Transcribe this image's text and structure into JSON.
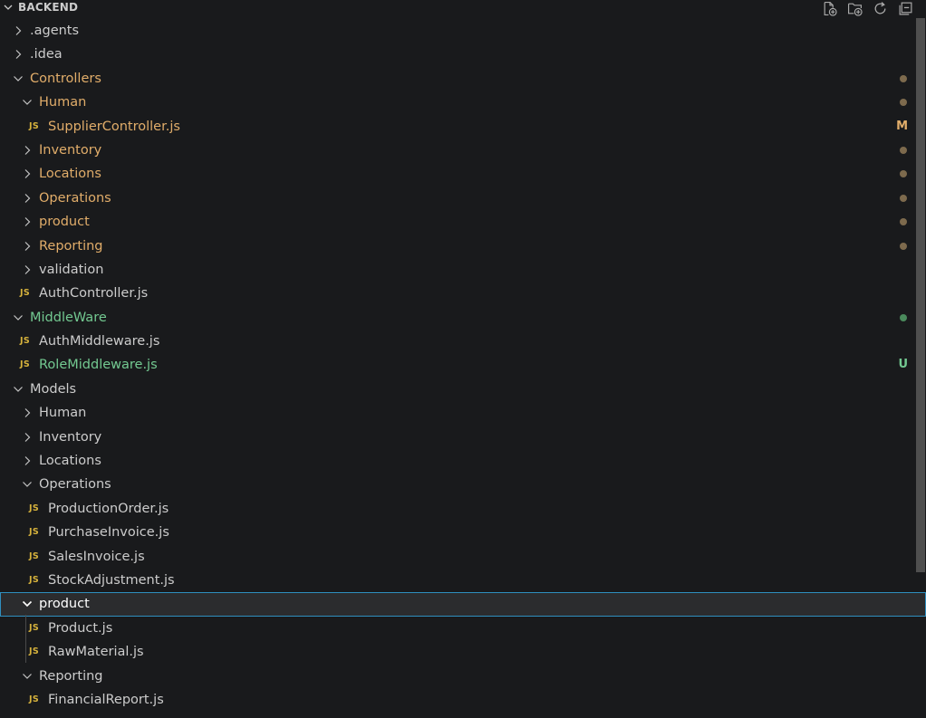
{
  "header": {
    "title": "BACKEND",
    "actions": [
      {
        "icon": "new-file-icon"
      },
      {
        "icon": "new-folder-icon"
      },
      {
        "icon": "refresh-icon"
      },
      {
        "icon": "collapse-all-icon"
      }
    ]
  },
  "colors": {
    "default": "#cccccc",
    "modified": "#e1ad6a",
    "untracked": "#73c991",
    "modified_dot": "#7d6a4d",
    "untracked_dot": "#4a8a5c",
    "js_icon": "#d6b23c",
    "selection_border": "#2f8fbf"
  },
  "tree": [
    {
      "label": ".agents",
      "type": "folder",
      "expanded": false,
      "depth": 0,
      "status": "default"
    },
    {
      "label": ".idea",
      "type": "folder",
      "expanded": false,
      "depth": 0,
      "status": "default"
    },
    {
      "label": "Controllers",
      "type": "folder",
      "expanded": true,
      "depth": 0,
      "status": "modified",
      "decoration": "dot"
    },
    {
      "label": "Human",
      "type": "folder",
      "expanded": true,
      "depth": 1,
      "status": "modified",
      "decoration": "dot"
    },
    {
      "label": "SupplierController.js",
      "type": "file",
      "depth": 2,
      "status": "modified",
      "decoration": "M"
    },
    {
      "label": "Inventory",
      "type": "folder",
      "expanded": false,
      "depth": 1,
      "status": "modified",
      "decoration": "dot"
    },
    {
      "label": "Locations",
      "type": "folder",
      "expanded": false,
      "depth": 1,
      "status": "modified",
      "decoration": "dot"
    },
    {
      "label": "Operations",
      "type": "folder",
      "expanded": false,
      "depth": 1,
      "status": "modified",
      "decoration": "dot"
    },
    {
      "label": "product",
      "type": "folder",
      "expanded": false,
      "depth": 1,
      "status": "modified",
      "decoration": "dot"
    },
    {
      "label": "Reporting",
      "type": "folder",
      "expanded": false,
      "depth": 1,
      "status": "modified",
      "decoration": "dot"
    },
    {
      "label": "validation",
      "type": "folder",
      "expanded": false,
      "depth": 1,
      "status": "default"
    },
    {
      "label": "AuthController.js",
      "type": "file",
      "depth": 1,
      "status": "default"
    },
    {
      "label": "MiddleWare",
      "type": "folder",
      "expanded": true,
      "depth": 0,
      "status": "untracked",
      "decoration": "dot"
    },
    {
      "label": "AuthMiddleware.js",
      "type": "file",
      "depth": 1,
      "status": "default"
    },
    {
      "label": "RoleMiddleware.js",
      "type": "file",
      "depth": 1,
      "status": "untracked",
      "decoration": "U"
    },
    {
      "label": "Models",
      "type": "folder",
      "expanded": true,
      "depth": 0,
      "status": "default"
    },
    {
      "label": "Human",
      "type": "folder",
      "expanded": false,
      "depth": 1,
      "status": "default"
    },
    {
      "label": "Inventory",
      "type": "folder",
      "expanded": false,
      "depth": 1,
      "status": "default"
    },
    {
      "label": "Locations",
      "type": "folder",
      "expanded": false,
      "depth": 1,
      "status": "default"
    },
    {
      "label": "Operations",
      "type": "folder",
      "expanded": true,
      "depth": 1,
      "status": "default"
    },
    {
      "label": "ProductionOrder.js",
      "type": "file",
      "depth": 2,
      "status": "default"
    },
    {
      "label": "PurchaseInvoice.js",
      "type": "file",
      "depth": 2,
      "status": "default"
    },
    {
      "label": "SalesInvoice.js",
      "type": "file",
      "depth": 2,
      "status": "default"
    },
    {
      "label": "StockAdjustment.js",
      "type": "file",
      "depth": 2,
      "status": "default"
    },
    {
      "label": "product",
      "type": "folder",
      "expanded": true,
      "depth": 1,
      "status": "default",
      "selected": true
    },
    {
      "label": "Product.js",
      "type": "file",
      "depth": 2,
      "status": "default"
    },
    {
      "label": "RawMaterial.js",
      "type": "file",
      "depth": 2,
      "status": "default"
    },
    {
      "label": "Reporting",
      "type": "folder",
      "expanded": true,
      "depth": 1,
      "status": "default"
    },
    {
      "label": "FinancialReport.js",
      "type": "file",
      "depth": 2,
      "status": "default"
    }
  ],
  "file_icon_text": "JS"
}
